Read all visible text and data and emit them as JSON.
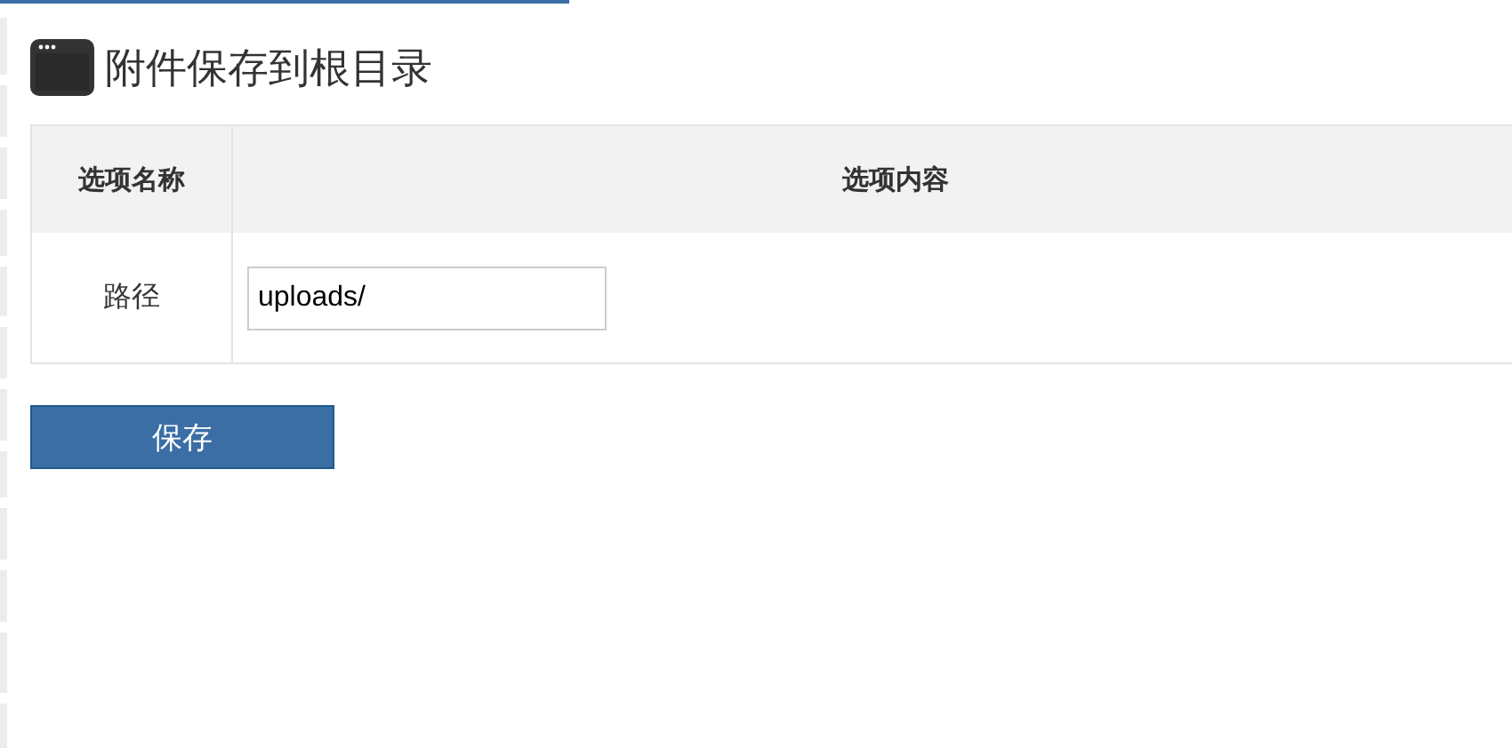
{
  "title": "附件保存到根目录",
  "table": {
    "columns": [
      "选项名称",
      "选项内容"
    ],
    "rows": [
      {
        "label": "路径",
        "value": "uploads/"
      }
    ]
  },
  "buttons": [
    "保存"
  ]
}
